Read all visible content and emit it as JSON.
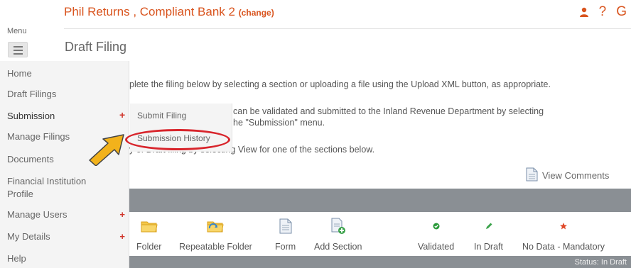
{
  "header": {
    "title": "Phil Returns , Compliant Bank 2",
    "change_link": "(change)",
    "help_icon": "?",
    "logout_icon": "G"
  },
  "menu": {
    "label": "Menu"
  },
  "page_title": "Draft Filing",
  "sidebar": {
    "items": [
      {
        "label": "Home",
        "has_plus": false
      },
      {
        "label": "Draft Filings",
        "has_plus": false
      },
      {
        "label": "Submission",
        "has_plus": true
      },
      {
        "label": "Manage Filings",
        "has_plus": true
      },
      {
        "label": "Documents",
        "has_plus": false
      },
      {
        "label": "Financial Institution",
        "label2": "Profile",
        "has_plus": false
      },
      {
        "label": "Manage Users",
        "has_plus": true
      },
      {
        "label": "My Details",
        "has_plus": true
      },
      {
        "label": "Help",
        "has_plus": false
      }
    ],
    "plus_symbol": "+"
  },
  "submenu": {
    "items": [
      {
        "label": "Submit Filing"
      },
      {
        "label": "Submission History"
      }
    ]
  },
  "content": {
    "line1": "plete the filing below by selecting a section or uploading a file using the Upload XML button, as appropriate.",
    "line2a": "can be validated and submitted to the Inland Revenue Department by selecting",
    "line2b": "he \"Submission\" menu.",
    "line3": "y of Draft filing by selecting View for one of the sections below."
  },
  "view_comments": "View Comments",
  "legend": [
    {
      "label": "Folder",
      "icon": "folder-icon"
    },
    {
      "label": "Repeatable Folder",
      "icon": "repeatable-folder-icon"
    },
    {
      "label": "Form",
      "icon": "form-icon"
    },
    {
      "label": "Add Section",
      "icon": "add-section-icon"
    },
    {
      "label": "Validated",
      "icon": "validated-icon"
    },
    {
      "label": "In Draft",
      "icon": "in-draft-icon"
    },
    {
      "label": "No Data - Mandatory",
      "icon": "mandatory-star-icon"
    }
  ],
  "status": "Status: In Draft",
  "colors": {
    "brand": "#d9541e",
    "plus": "#d0352b",
    "highlight": "#d8242b",
    "arrow": "#f2b21b",
    "table_bar": "#8a8f94",
    "validated": "#2a9a3a"
  }
}
